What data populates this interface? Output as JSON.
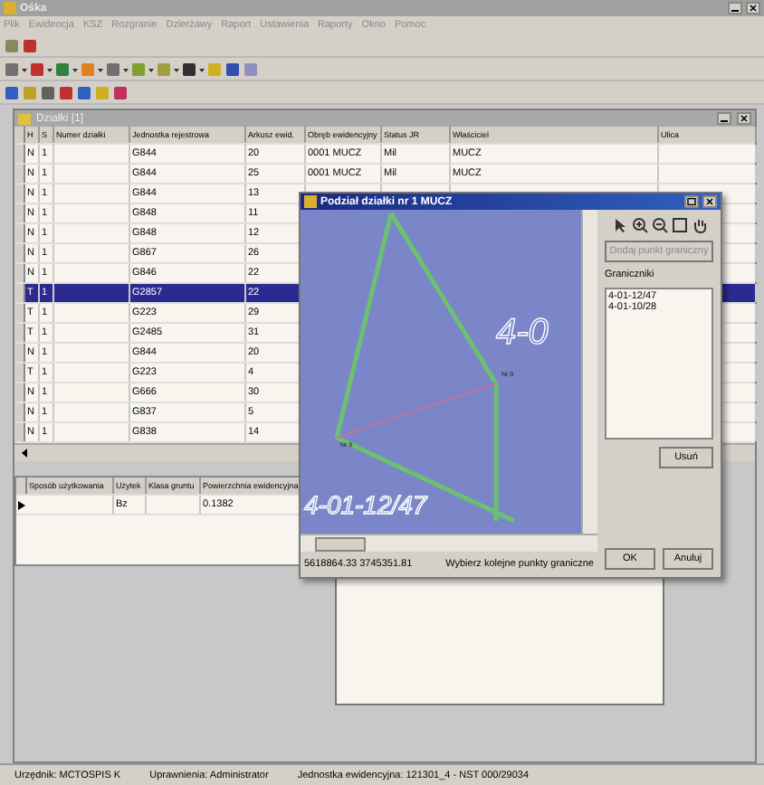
{
  "window": {
    "title": "Ośka"
  },
  "menu": [
    "Plik",
    "Ewidencja",
    "KSZ",
    "Rozgranie",
    "Dzierżawy",
    "Raport",
    "Ustawienia",
    "Raporty",
    "Okno",
    "Pomoc"
  ],
  "child_window": {
    "title": "Działki [1]"
  },
  "table": {
    "columns": [
      "H",
      "S",
      "Numer działki",
      "Jednostka rejestrowa",
      "Arkusz ewid.",
      "Obręb ewidencyjny",
      "Status JR",
      "Właściciel",
      "Ulica"
    ],
    "rows": [
      {
        "cells": [
          "N",
          "1",
          "",
          "G844",
          "20",
          "0001 MUCZ",
          "Mil",
          "MUCZ"
        ],
        "selected": false
      },
      {
        "cells": [
          "N",
          "1",
          "",
          "G844",
          "25",
          "0001 MUCZ",
          "Mil",
          "MUCZ"
        ],
        "selected": false
      },
      {
        "cells": [
          "N",
          "1",
          "",
          "G844",
          "13"
        ],
        "selected": false
      },
      {
        "cells": [
          "N",
          "1",
          "",
          "G848",
          "11"
        ],
        "selected": false
      },
      {
        "cells": [
          "N",
          "1",
          "",
          "G848",
          "12"
        ],
        "selected": false
      },
      {
        "cells": [
          "N",
          "1",
          "",
          "G867",
          "26"
        ],
        "selected": false
      },
      {
        "cells": [
          "N",
          "1",
          "",
          "G846",
          "22"
        ],
        "selected": false
      },
      {
        "cells": [
          "T",
          "1",
          "",
          "G2857",
          "22"
        ],
        "selected": true
      },
      {
        "cells": [
          "T",
          "1",
          "",
          "G223",
          "29"
        ],
        "selected": false
      },
      {
        "cells": [
          "T",
          "1",
          "",
          "G2485",
          "31"
        ],
        "selected": false
      },
      {
        "cells": [
          "N",
          "1",
          "",
          "G844",
          "20"
        ],
        "selected": false
      },
      {
        "cells": [
          "T",
          "1",
          "",
          "G223",
          "4"
        ],
        "selected": false
      },
      {
        "cells": [
          "N",
          "1",
          "",
          "G666",
          "30"
        ],
        "selected": false
      },
      {
        "cells": [
          "N",
          "1",
          "",
          "G837",
          "5"
        ],
        "selected": false
      },
      {
        "cells": [
          "N",
          "1",
          "",
          "G838",
          "14"
        ],
        "selected": false
      }
    ]
  },
  "detail_table": {
    "columns": [
      "Sposób użytkowania",
      "Użytek",
      "Klasa gruntu",
      "Powierzchnia ewidencyjna"
    ],
    "rows": [
      {
        "cells": [
          "",
          "Bz",
          "",
          "0.1382"
        ]
      }
    ]
  },
  "dialog": {
    "title": "Podział działki nr 1 MUCZ",
    "map_labels": [
      "4-0",
      "4-01-12/47"
    ],
    "point_labels": [
      "Nr 8",
      "Nr 9"
    ],
    "action_button": {
      "label": "Dodaj punkt graniczny",
      "disabled": true
    },
    "points_label": "Graniczniki",
    "points": [
      "4-01-12/47",
      "4-01-10/28"
    ],
    "remove_button": "Usuń",
    "coordinates": "5618864.33   3745351.81",
    "hint": "Wybierz kolejne punkty graniczne",
    "buttons": [
      "OK",
      "Anuluj"
    ]
  },
  "status_bar": [
    "Urzędnik: MCTOSPIS K",
    "Uprawnienia: Administrator",
    "Jednostka ewidencyjna: 121301_4 - NST 000/29034"
  ]
}
